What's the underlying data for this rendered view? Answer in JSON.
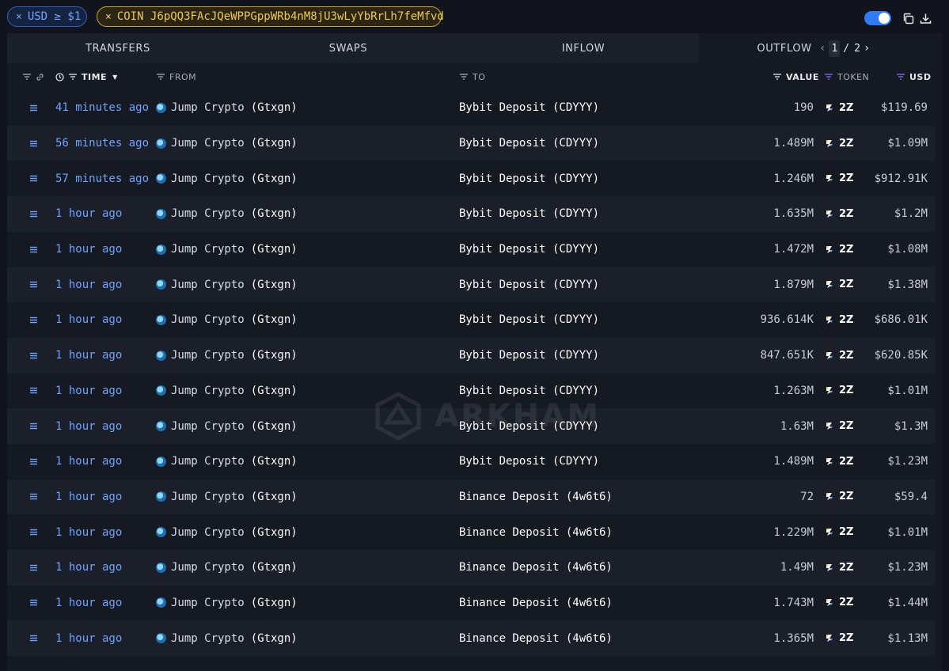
{
  "filters": {
    "usd_chip": "USD ≥ $1",
    "coin_chip": "COIN J6pQQ3FAcJQeWPPGppWRb4nM8jU3wLyYbRrLh7feMfvd",
    "remove_icon": "×"
  },
  "toolbar": {
    "toggle_on": true,
    "icons": [
      "copy-icon",
      "download-icon"
    ]
  },
  "tabs": [
    {
      "label": "TRANSFERS"
    },
    {
      "label": "SWAPS"
    },
    {
      "label": "INFLOW"
    },
    {
      "label": "OUTFLOW"
    }
  ],
  "active_tab": "OUTFLOW",
  "pagination": {
    "current": "1",
    "separator": "/",
    "total": "2"
  },
  "columns": {
    "time": "TIME",
    "from": "FROM",
    "to": "TO",
    "value": "VALUE",
    "token": "TOKEN",
    "usd": "USD"
  },
  "watermark": "ARKHAM",
  "rows": [
    {
      "time": "41 minutes ago",
      "from_name": "Jump Crypto",
      "from_handle": "(Gtxgn)",
      "to": "Bybit Deposit (CDYYY)",
      "value": "190",
      "token": "2Z",
      "usd": "$119.69"
    },
    {
      "time": "56 minutes ago",
      "from_name": "Jump Crypto",
      "from_handle": "(Gtxgn)",
      "to": "Bybit Deposit (CDYYY)",
      "value": "1.489M",
      "token": "2Z",
      "usd": "$1.09M"
    },
    {
      "time": "57 minutes ago",
      "from_name": "Jump Crypto",
      "from_handle": "(Gtxgn)",
      "to": "Bybit Deposit (CDYYY)",
      "value": "1.246M",
      "token": "2Z",
      "usd": "$912.91K"
    },
    {
      "time": "1 hour ago",
      "from_name": "Jump Crypto",
      "from_handle": "(Gtxgn)",
      "to": "Bybit Deposit (CDYYY)",
      "value": "1.635M",
      "token": "2Z",
      "usd": "$1.2M"
    },
    {
      "time": "1 hour ago",
      "from_name": "Jump Crypto",
      "from_handle": "(Gtxgn)",
      "to": "Bybit Deposit (CDYYY)",
      "value": "1.472M",
      "token": "2Z",
      "usd": "$1.08M"
    },
    {
      "time": "1 hour ago",
      "from_name": "Jump Crypto",
      "from_handle": "(Gtxgn)",
      "to": "Bybit Deposit (CDYYY)",
      "value": "1.879M",
      "token": "2Z",
      "usd": "$1.38M"
    },
    {
      "time": "1 hour ago",
      "from_name": "Jump Crypto",
      "from_handle": "(Gtxgn)",
      "to": "Bybit Deposit (CDYYY)",
      "value": "936.614K",
      "token": "2Z",
      "usd": "$686.01K"
    },
    {
      "time": "1 hour ago",
      "from_name": "Jump Crypto",
      "from_handle": "(Gtxgn)",
      "to": "Bybit Deposit (CDYYY)",
      "value": "847.651K",
      "token": "2Z",
      "usd": "$620.85K"
    },
    {
      "time": "1 hour ago",
      "from_name": "Jump Crypto",
      "from_handle": "(Gtxgn)",
      "to": "Bybit Deposit (CDYYY)",
      "value": "1.263M",
      "token": "2Z",
      "usd": "$1.01M"
    },
    {
      "time": "1 hour ago",
      "from_name": "Jump Crypto",
      "from_handle": "(Gtxgn)",
      "to": "Bybit Deposit (CDYYY)",
      "value": "1.63M",
      "token": "2Z",
      "usd": "$1.3M"
    },
    {
      "time": "1 hour ago",
      "from_name": "Jump Crypto",
      "from_handle": "(Gtxgn)",
      "to": "Bybit Deposit (CDYYY)",
      "value": "1.489M",
      "token": "2Z",
      "usd": "$1.23M"
    },
    {
      "time": "1 hour ago",
      "from_name": "Jump Crypto",
      "from_handle": "(Gtxgn)",
      "to": "Binance Deposit (4w6t6)",
      "value": "72",
      "token": "2Z",
      "usd": "$59.4"
    },
    {
      "time": "1 hour ago",
      "from_name": "Jump Crypto",
      "from_handle": "(Gtxgn)",
      "to": "Binance Deposit (4w6t6)",
      "value": "1.229M",
      "token": "2Z",
      "usd": "$1.01M"
    },
    {
      "time": "1 hour ago",
      "from_name": "Jump Crypto",
      "from_handle": "(Gtxgn)",
      "to": "Binance Deposit (4w6t6)",
      "value": "1.49M",
      "token": "2Z",
      "usd": "$1.23M"
    },
    {
      "time": "1 hour ago",
      "from_name": "Jump Crypto",
      "from_handle": "(Gtxgn)",
      "to": "Binance Deposit (4w6t6)",
      "value": "1.743M",
      "token": "2Z",
      "usd": "$1.44M"
    },
    {
      "time": "1 hour ago",
      "from_name": "Jump Crypto",
      "from_handle": "(Gtxgn)",
      "to": "Binance Deposit (4w6t6)",
      "value": "1.365M",
      "token": "2Z",
      "usd": "$1.13M"
    }
  ],
  "colors": {
    "background": "#11141c",
    "accent_blue": "#6fa3ff",
    "coin_chip_gold": "#f1c94a",
    "toggle_blue": "#2f7cf6",
    "token_filter_purple": "#8b6cf6"
  }
}
